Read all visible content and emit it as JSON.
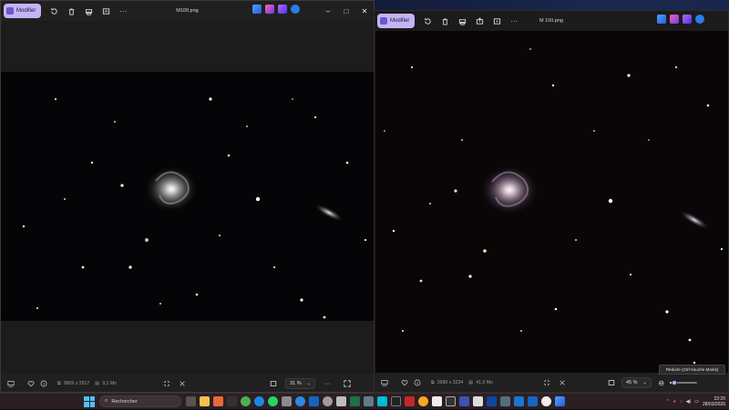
{
  "left_window": {
    "title": "M100.png",
    "modify_label": "Modifier",
    "status": {
      "dimensions": "3809 x 2517",
      "size": "9,2 Mo",
      "zoom": "31 %"
    }
  },
  "right_window": {
    "title": "M 100.png",
    "modify_label": "Modifier",
    "status": {
      "dimensions": "3990 x 3234",
      "size": "41,9 Mo",
      "zoom": "45 %"
    },
    "tooltip": "Réduire (Ctrl+touche Moins)"
  },
  "taskbar": {
    "search_placeholder": "Rechercher",
    "clock_time": "22:20",
    "clock_date": "28/03/2026"
  },
  "icons": {
    "titlebar": [
      "rotate-icon",
      "delete-icon",
      "print-icon",
      "edit-icon",
      "more-icon"
    ],
    "status": [
      "filmstrip-icon",
      "favorite-icon",
      "info-icon",
      "fit-icon",
      "zoom-out-icon",
      "fullscreen-icon"
    ]
  },
  "colors": {
    "accent": "#c4b4f6",
    "window_bg": "#202020",
    "sky_left": "#050507",
    "sky_right": "#0a0608",
    "windows_blue": "#4cc2ff"
  }
}
